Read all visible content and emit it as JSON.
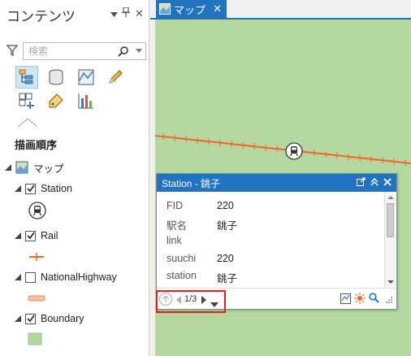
{
  "contents_pane": {
    "title": "コンテンツ",
    "pin_label": "⊥",
    "close_label": "✕",
    "search_placeholder": "検索"
  },
  "draw_order": {
    "heading": "描画順序",
    "map_label": "マップ",
    "layers": [
      {
        "label": "Station",
        "checked": true
      },
      {
        "label": "Rail",
        "checked": true
      },
      {
        "label": "NationalHighway",
        "checked": false
      },
      {
        "label": "Boundary",
        "checked": true
      }
    ]
  },
  "map_view": {
    "tab_label": "マップ",
    "tab_close": "✕"
  },
  "popup": {
    "title": "Station - 銚子",
    "attributes": [
      {
        "name": "FID",
        "value": "220"
      },
      {
        "name": "駅名",
        "value": "銚子"
      },
      {
        "name": "link",
        "value": ""
      },
      {
        "name": "suuchi",
        "value": "220"
      },
      {
        "name": "station",
        "value": "銚子"
      }
    ],
    "nav_count": "1/3"
  },
  "colors": {
    "accent": "#1f73c1",
    "map_background": "#b5d8a0",
    "rail_line": "#f26522",
    "highlight_box": "#e02020",
    "boundary_swatch": "#b5d8a0",
    "highway_swatch": "#f6c2a4"
  }
}
